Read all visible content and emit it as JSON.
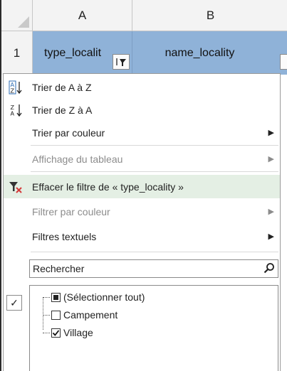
{
  "sheet": {
    "columns": [
      "A",
      "B"
    ],
    "row_number": "1",
    "cells": {
      "a1": "type_localit",
      "b1": "name_locality"
    }
  },
  "menu": {
    "items": [
      {
        "label": "Trier de A à Z",
        "icon": "sort-ascending-icon",
        "submenu": false,
        "disabled": false
      },
      {
        "label": "Trier de Z à A",
        "icon": "sort-descending-icon",
        "submenu": false,
        "disabled": false
      },
      {
        "label": "Trier par couleur",
        "icon": "",
        "submenu": true,
        "disabled": false
      },
      {
        "label": "Affichage du tableau",
        "icon": "",
        "submenu": true,
        "disabled": true
      },
      {
        "label": "Effacer le filtre de « type_locality »",
        "icon": "clear-filter-icon",
        "submenu": false,
        "disabled": false
      },
      {
        "label": "Filtrer par couleur",
        "icon": "",
        "submenu": true,
        "disabled": true
      },
      {
        "label": "Filtres textuels",
        "icon": "",
        "submenu": true,
        "disabled": false
      }
    ],
    "submenu_glyph": "▶"
  },
  "search": {
    "placeholder": "Rechercher"
  },
  "filter_list": {
    "items": [
      {
        "label": "(Sélectionner tout)",
        "state": "partial"
      },
      {
        "label": "Campement",
        "state": "unchecked"
      },
      {
        "label": "Village",
        "state": "checked"
      }
    ],
    "ok_glyph": "✓"
  },
  "colors": {
    "header_fill": "#8fb2d8",
    "highlight": "#e4efe4",
    "clear_filter_red": "#d43a3a"
  }
}
